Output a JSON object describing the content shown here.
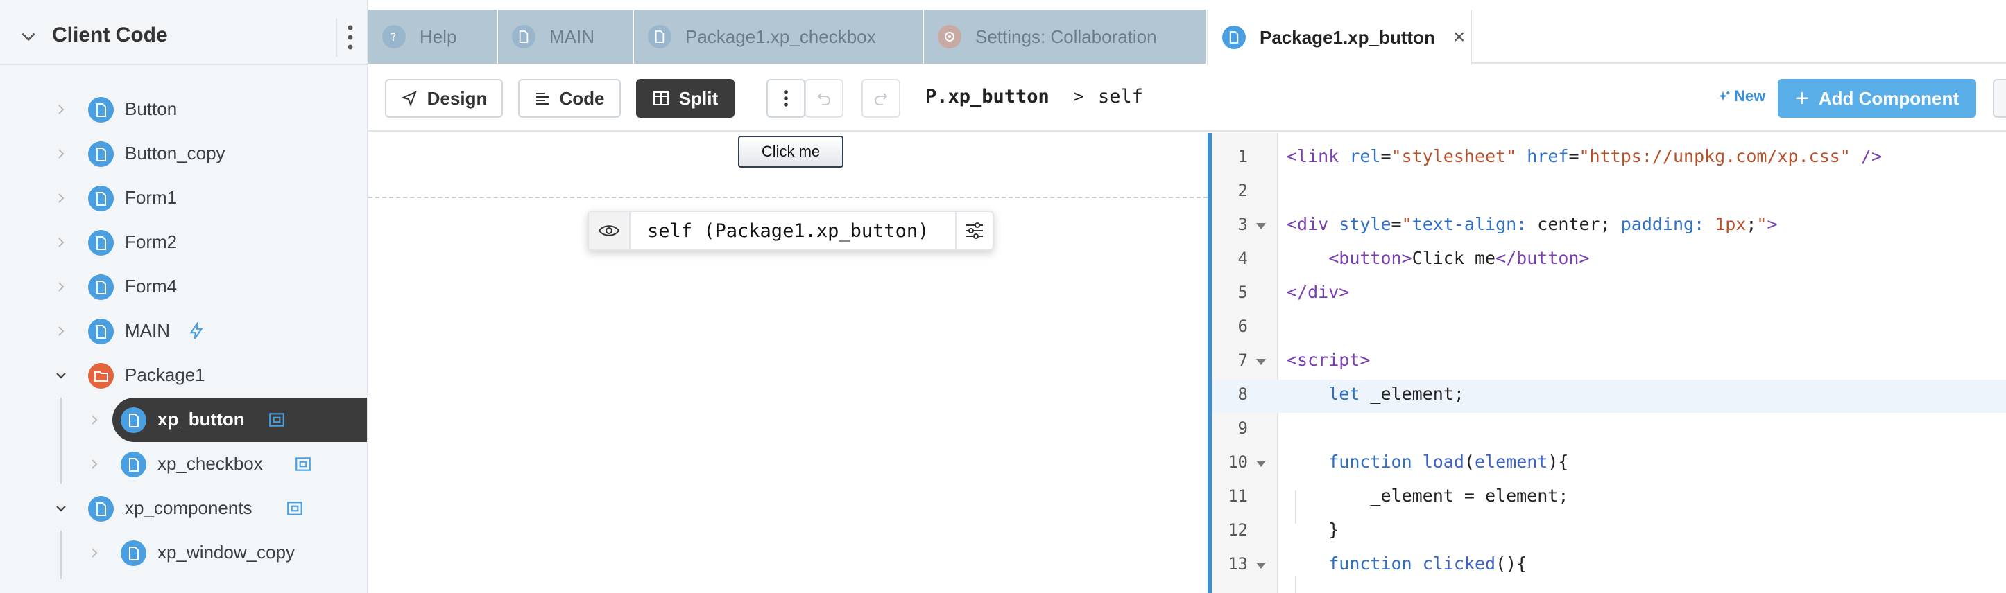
{
  "sidebar": {
    "title": "Client Code",
    "items": [
      {
        "label": "Button",
        "icon": "file-icon"
      },
      {
        "label": "Button_copy",
        "icon": "file-icon"
      },
      {
        "label": "Form1",
        "icon": "file-icon"
      },
      {
        "label": "Form2",
        "icon": "file-icon"
      },
      {
        "label": "Form4",
        "icon": "file-icon"
      },
      {
        "label": "MAIN",
        "icon": "file-icon",
        "badge": "bolt-icon"
      },
      {
        "label": "Package1",
        "icon": "folder-icon",
        "expanded": true
      },
      {
        "label": "xp_button",
        "icon": "file-icon",
        "badge": "component-icon",
        "selected": true
      },
      {
        "label": "xp_checkbox",
        "icon": "file-icon",
        "badge": "component-icon"
      },
      {
        "label": "xp_components",
        "icon": "file-icon",
        "badge": "component-icon",
        "expanded": true
      },
      {
        "label": "xp_window_copy",
        "icon": "file-icon"
      }
    ]
  },
  "tabs": [
    {
      "label": "Help",
      "icon": "help-icon"
    },
    {
      "label": "MAIN",
      "icon": "file-icon"
    },
    {
      "label": "Package1.xp_checkbox",
      "icon": "file-icon"
    },
    {
      "label": "Settings: Collaboration",
      "icon": "settings-icon"
    },
    {
      "label": "Package1.xp_button",
      "icon": "file-icon",
      "active": true,
      "close": "×"
    }
  ],
  "toolbar": {
    "design_label": "Design",
    "code_label": "Code",
    "split_label": "Split",
    "breadcrumb_module": "P.xp_button",
    "breadcrumb_sep": ">",
    "breadcrumb_item": "self",
    "new_label": "New",
    "add_component_label": "Add Component"
  },
  "canvas": {
    "preview_button_label": "Click me",
    "selection_label": "self (Package1.xp_button)"
  },
  "editor": {
    "active_line": 8,
    "line_numbers": [
      "1",
      "2",
      "3",
      "4",
      "5",
      "6",
      "7",
      "8",
      "9",
      "10",
      "11",
      "12",
      "13"
    ]
  },
  "colors": {
    "accent": "#4a9fe0",
    "folder": "#e4643f",
    "selected_bg": "#3b3b3b",
    "add_button": "#5aaee8"
  }
}
